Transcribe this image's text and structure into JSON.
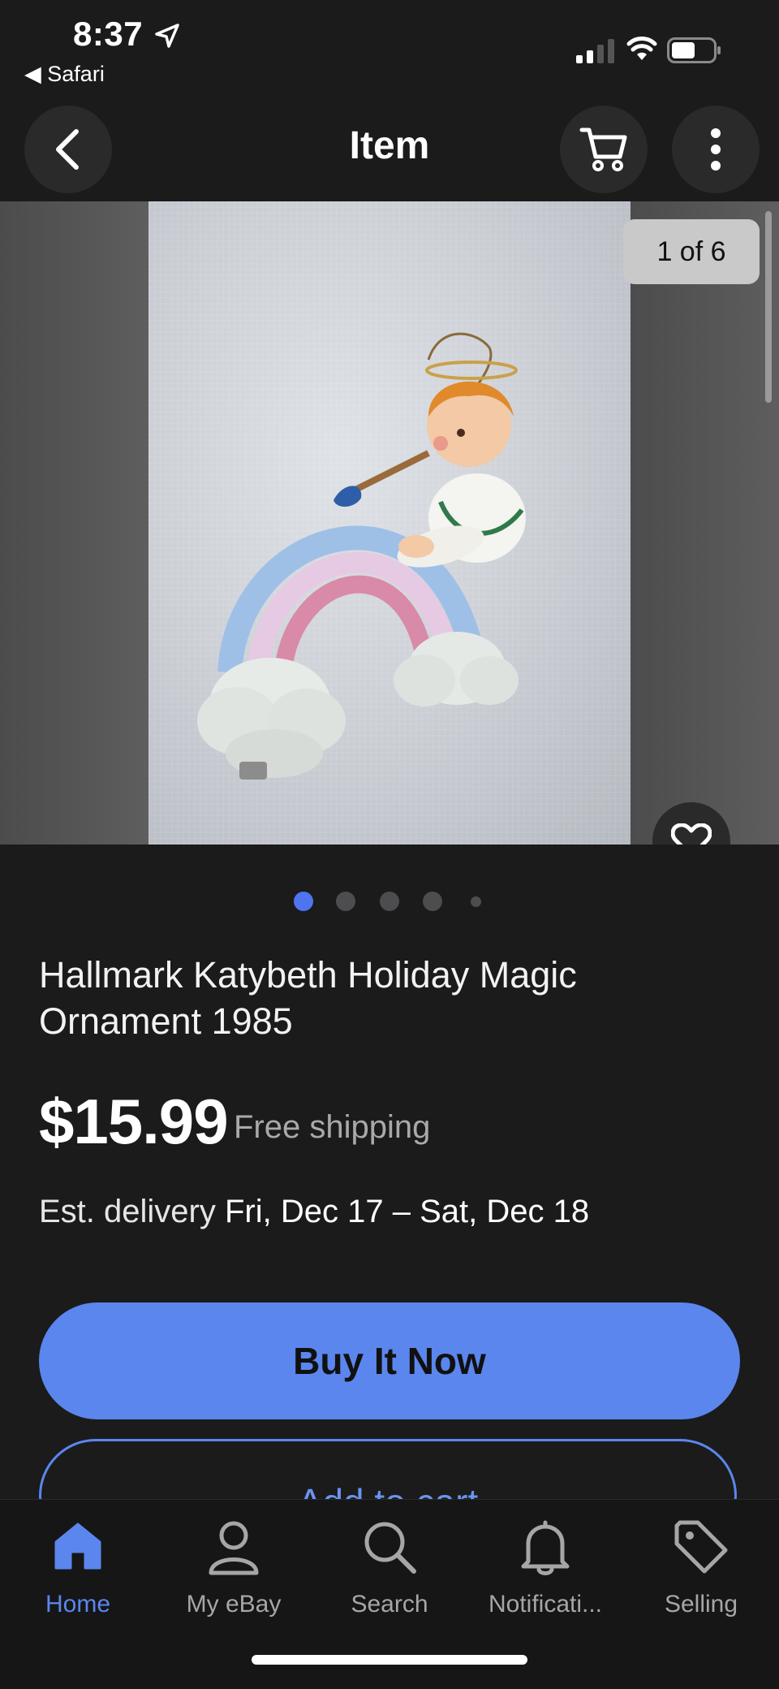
{
  "status_bar": {
    "time": "8:37",
    "back_app": "Safari"
  },
  "top_bar": {
    "title": "Item"
  },
  "gallery": {
    "counter": "1 of 6",
    "current_index": 1,
    "total_images": 6
  },
  "item": {
    "title": "Hallmark Katybeth Holiday Magic Ornament 1985",
    "price": "$15.99",
    "shipping": "Free shipping",
    "delivery_label": "Est. delivery",
    "delivery_dates": "Fri, Dec 17 – Sat, Dec 18"
  },
  "actions": {
    "buy_now": "Buy It Now",
    "add_to_cart": "Add to cart"
  },
  "tab_bar": {
    "items": [
      {
        "label": "Home",
        "icon": "home-icon",
        "active": true
      },
      {
        "label": "My eBay",
        "icon": "person-icon",
        "active": false
      },
      {
        "label": "Search",
        "icon": "search-icon",
        "active": false
      },
      {
        "label": "Notificati...",
        "icon": "bell-icon",
        "active": false
      },
      {
        "label": "Selling",
        "icon": "tag-icon",
        "active": false
      }
    ]
  },
  "colors": {
    "background": "#1b1b1c",
    "accent": "#5b86ee",
    "muted_text": "#a9a9ab"
  }
}
